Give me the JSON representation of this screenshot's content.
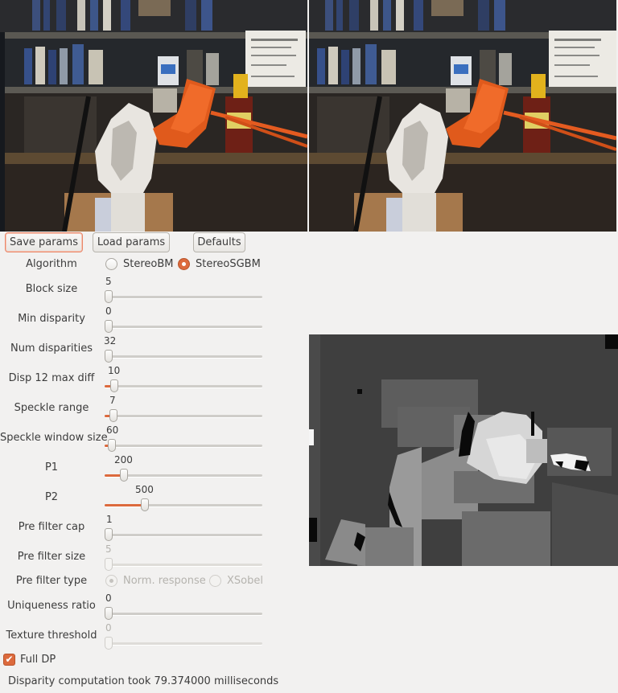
{
  "buttons": {
    "save": "Save params",
    "load": "Load params",
    "defaults": "Defaults"
  },
  "algorithm": {
    "label": "Algorithm",
    "options": [
      "StereoBM",
      "StereoSGBM"
    ],
    "selected": "StereoSGBM"
  },
  "params": {
    "block_size": {
      "label": "Block size",
      "value": "5",
      "fraction": 0.0
    },
    "min_disparity": {
      "label": "Min disparity",
      "value": "0",
      "fraction": 0.0
    },
    "num_disparities": {
      "label": "Num disparities",
      "value": "32",
      "fraction": 0.0
    },
    "disp12_max_diff": {
      "label": "Disp 12 max diff",
      "value": "10",
      "fraction": 0.04
    },
    "speckle_range": {
      "label": "Speckle range",
      "value": "7",
      "fraction": 0.03
    },
    "speckle_window_size": {
      "label": "Speckle window size",
      "value": "60",
      "fraction": 0.02
    },
    "p1": {
      "label": "P1",
      "value": "200",
      "fraction": 0.1
    },
    "p2": {
      "label": "P2",
      "value": "500",
      "fraction": 0.24
    },
    "pre_filter_cap": {
      "label": "Pre filter cap",
      "value": "1",
      "fraction": 0.0
    },
    "pre_filter_size": {
      "label": "Pre filter size",
      "value": "5",
      "fraction": 0.0
    },
    "uniqueness_ratio": {
      "label": "Uniqueness ratio",
      "value": "0",
      "fraction": 0.0
    },
    "texture_threshold": {
      "label": "Texture threshold",
      "value": "0",
      "fraction": 0.0
    }
  },
  "pre_filter_type": {
    "label": "Pre filter type",
    "options": [
      "Norm. response",
      "XSobel"
    ],
    "selected": "Norm. response"
  },
  "full_dp": {
    "label": "Full DP",
    "checked": true
  },
  "status": "Disparity computation took 79.374000 milliseconds",
  "colors": {
    "accent": "#dc6a3d",
    "background": "#f2f1f0"
  }
}
